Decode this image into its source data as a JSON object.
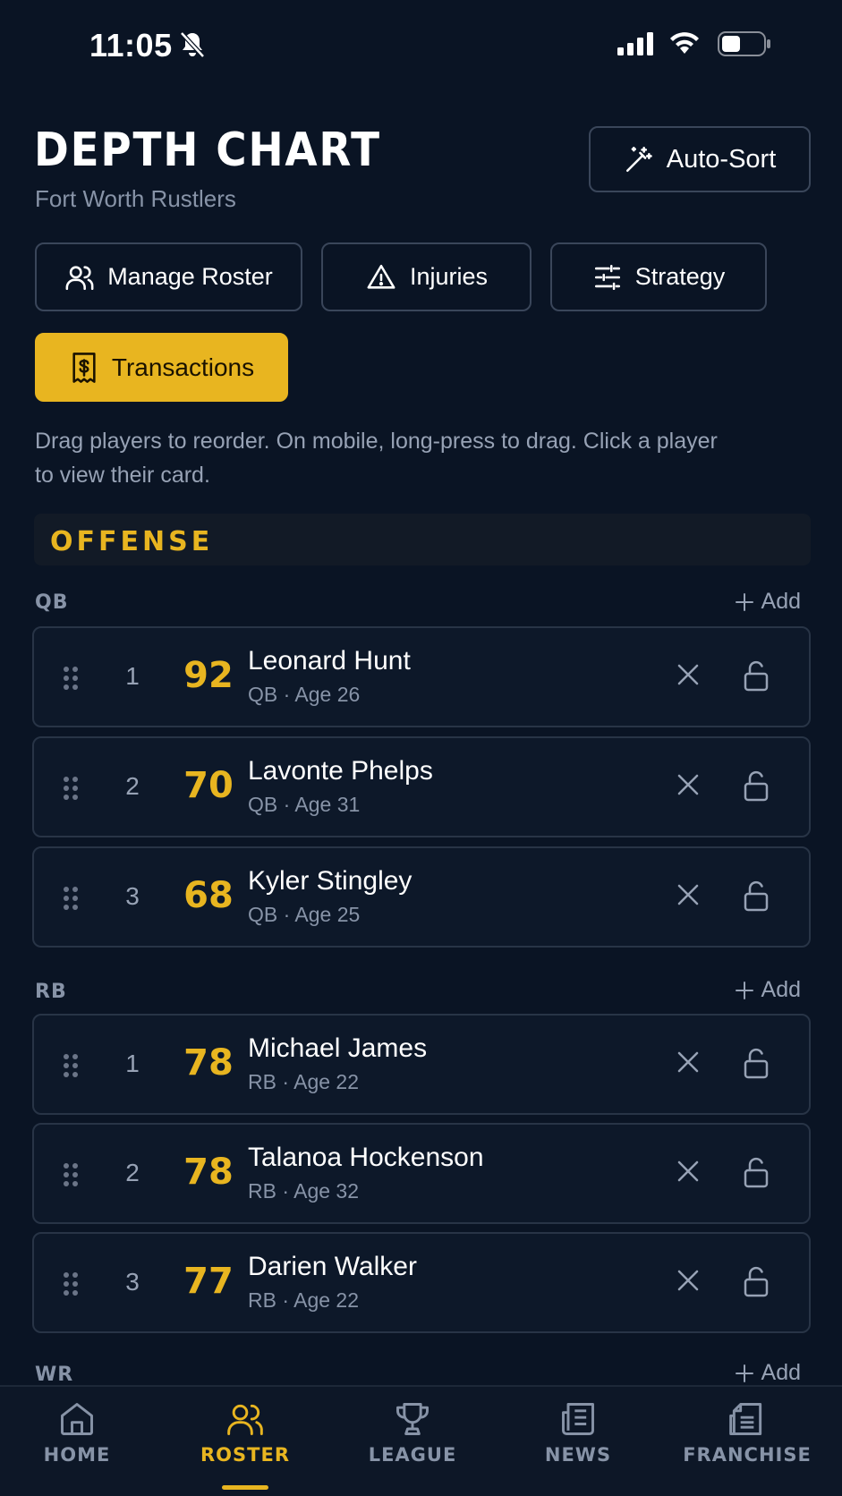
{
  "status_bar": {
    "time": "11:05"
  },
  "header": {
    "title": "DEPTH CHART",
    "team": "Fort Worth Rustlers",
    "auto_sort_label": "Auto-Sort"
  },
  "actions": {
    "manage_roster": "Manage Roster",
    "injuries": "Injuries",
    "strategy": "Strategy",
    "transactions": "Transactions"
  },
  "help_text": "Drag players to reorder. On mobile, long-press to drag. Click a player to view their card.",
  "section": {
    "title": "OFFENSE"
  },
  "add_label": "Add",
  "groups": [
    {
      "position": "QB",
      "players": [
        {
          "rank": "1",
          "ovr": "92",
          "name": "Leonard Hunt",
          "meta": "QB · Age 26"
        },
        {
          "rank": "2",
          "ovr": "70",
          "name": "Lavonte Phelps",
          "meta": "QB · Age 31"
        },
        {
          "rank": "3",
          "ovr": "68",
          "name": "Kyler Stingley",
          "meta": "QB · Age 25"
        }
      ]
    },
    {
      "position": "RB",
      "players": [
        {
          "rank": "1",
          "ovr": "78",
          "name": "Michael James",
          "meta": "RB · Age 22"
        },
        {
          "rank": "2",
          "ovr": "78",
          "name": "Talanoa Hockenson",
          "meta": "RB · Age 32"
        },
        {
          "rank": "3",
          "ovr": "77",
          "name": "Darien Walker",
          "meta": "RB · Age 22"
        }
      ]
    },
    {
      "position": "WR",
      "players": []
    }
  ],
  "nav": {
    "home": "HOME",
    "roster": "ROSTER",
    "league": "LEAGUE",
    "news": "NEWS",
    "franchise": "FRANCHISE",
    "active": "roster"
  },
  "colors": {
    "accent": "#e8b520",
    "background": "#0a1424",
    "muted": "#8793a7"
  }
}
